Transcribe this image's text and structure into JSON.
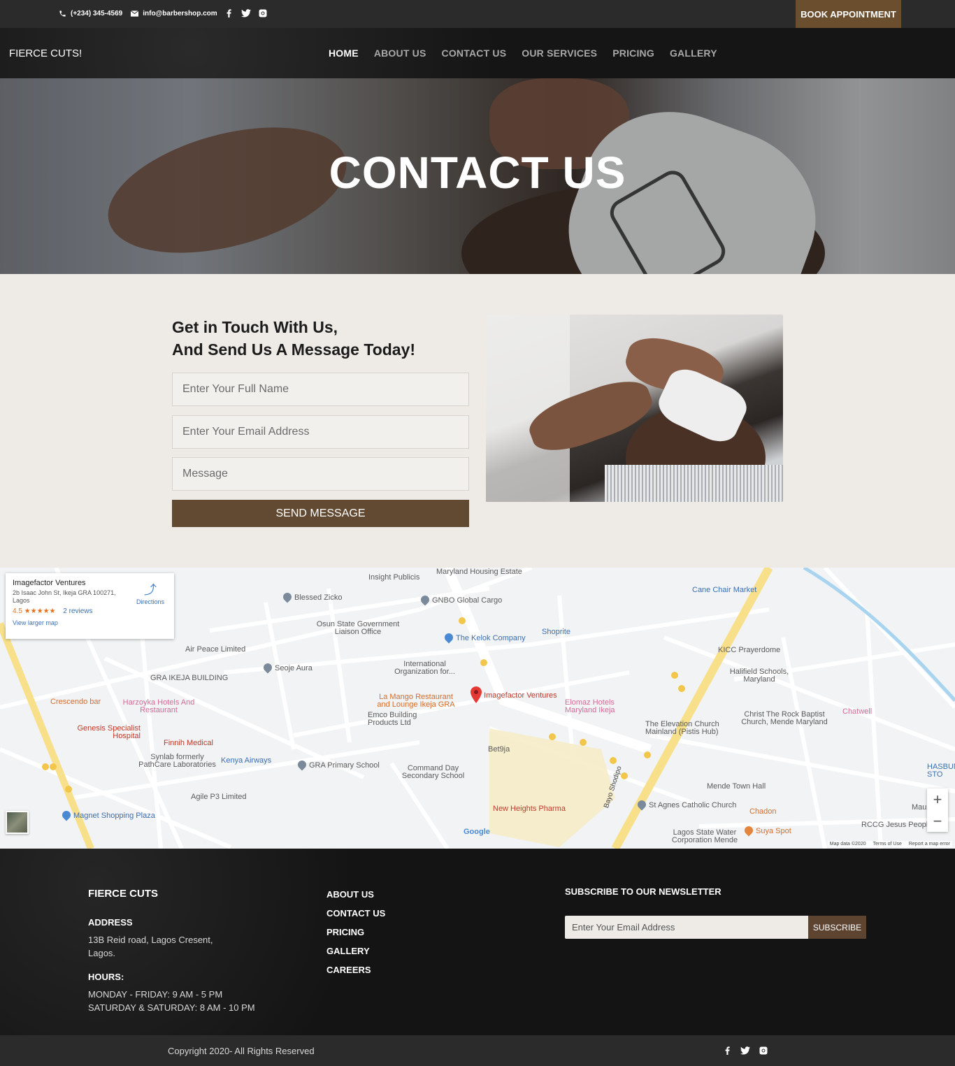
{
  "topbar": {
    "phone": "(+234) 345-4569",
    "email": "info@barbershop.com",
    "book_label": "BOOK APPOINTMENT",
    "social": [
      "facebook-icon",
      "twitter-icon",
      "instagram-icon"
    ]
  },
  "nav": {
    "brand": "FIERCE CUTS!",
    "items": [
      {
        "label": "HOME",
        "active": true
      },
      {
        "label": "ABOUT US"
      },
      {
        "label": "CONTACT US"
      },
      {
        "label": "OUR SERVICES"
      },
      {
        "label": "PRICING"
      },
      {
        "label": "GALLERY"
      }
    ]
  },
  "hero": {
    "title": "CONTACT US"
  },
  "contact": {
    "heading_line1": "Get in Touch With Us,",
    "heading_line2": "And Send Us A Message Today!",
    "name_placeholder": "Enter Your Full Name",
    "email_placeholder": "Enter Your Email Address",
    "message_placeholder": "Message",
    "send_label": "SEND MESSAGE"
  },
  "map": {
    "card": {
      "name": "Imagefactor Ventures",
      "address": "2b Isaac John St, Ikeja GRA 100271, Lagos",
      "rating": "4.5 ★★★★★",
      "reviews": "2 reviews",
      "directions": "Directions",
      "larger_map": "View larger map"
    },
    "labels": {
      "insight": "Insight Publicis",
      "maryland_housing": "Maryland Housing Estate",
      "cane_chair": "Cane Chair Market",
      "blessed_zicko": "Blessed Zicko",
      "gnbo": "GNBO Global Cargo",
      "osun": "Osun State Government Liaison Office",
      "kelok": "The Kelok Company",
      "shoprite": "Shoprite",
      "kicc": "KICC Prayerdome",
      "air_peace": "Air Peace Limited",
      "seoje": "Seoje Aura",
      "international": "International Organization for...",
      "gra_ikeja": "GRA IKEJA BUILDING",
      "halifield": "Halifield Schools, Maryland",
      "crescendo": "Crescendo bar",
      "harzoyka": "Harzoyka Hotels And Restaurant",
      "la_mango": "La Mango Restaurant and Lounge Ikeja GRA",
      "imagefactor": "Imagefactor Ventures",
      "elomaz": "Elomaz Hotels Maryland Ikeja",
      "chatwell": "Chatwell",
      "christ_rock": "Christ The Rock Baptist Church, Mende Maryland",
      "emco": "Emco Building Products Ltd",
      "elevation": "The Elevation Church Mainland (Pistis Hub)",
      "genesis": "Genesis Specialist Hospital",
      "finnih": "Finnih Medical",
      "bet9ja": "Bet9ja",
      "synlab": "Synlab formerly PathCare Laboratories",
      "kenya": "Kenya Airways",
      "gra_primary": "GRA Primary School",
      "command_day": "Command Day Secondary School",
      "mende_town": "Mende Town Hall",
      "hasbunalla": "HASBUNALLA STO",
      "agile": "Agile P3 Limited",
      "st_agnes": "St Agnes Catholic Church",
      "chadon": "Chadon",
      "new_heights": "New Heights Pharma",
      "magnet": "Magnet Shopping Plaza",
      "lagos_water": "Lagos State Water Corporation Mende",
      "suya": "Suya Spot",
      "rccg": "RCCG Jesus People",
      "bayo": "Bayo Shodipo",
      "mau": "Mau"
    },
    "google": "Google",
    "credits": [
      "Map data ©2020",
      "Terms of Use",
      "Report a map error"
    ]
  },
  "footer": {
    "brand": "FIERCE CUTS",
    "address_heading": "ADDRESS",
    "address": "13B Reid road, Lagos Cresent, Lagos.",
    "hours_heading": "HOURS:",
    "hours_line1": "MONDAY - FRIDAY: 9 AM - 5 PM",
    "hours_line2": "SATURDAY & SATURDAY: 8 AM - 10 PM",
    "links": [
      "ABOUT US",
      "CONTACT US",
      "PRICING",
      "GALLERY",
      "CAREERS"
    ],
    "newsletter_heading": "SUBSCRIBE TO OUR NEWSLETTER",
    "newsletter_placeholder": "Enter Your Email Address",
    "subscribe_label": "SUBSCRIBE",
    "copyright": "Copyright 2020- All Rights Reserved"
  },
  "colors": {
    "accent": "#624a32",
    "book_button": "#6b4e2e",
    "background": "#eeebe6",
    "dark": "#2b2b2b"
  }
}
